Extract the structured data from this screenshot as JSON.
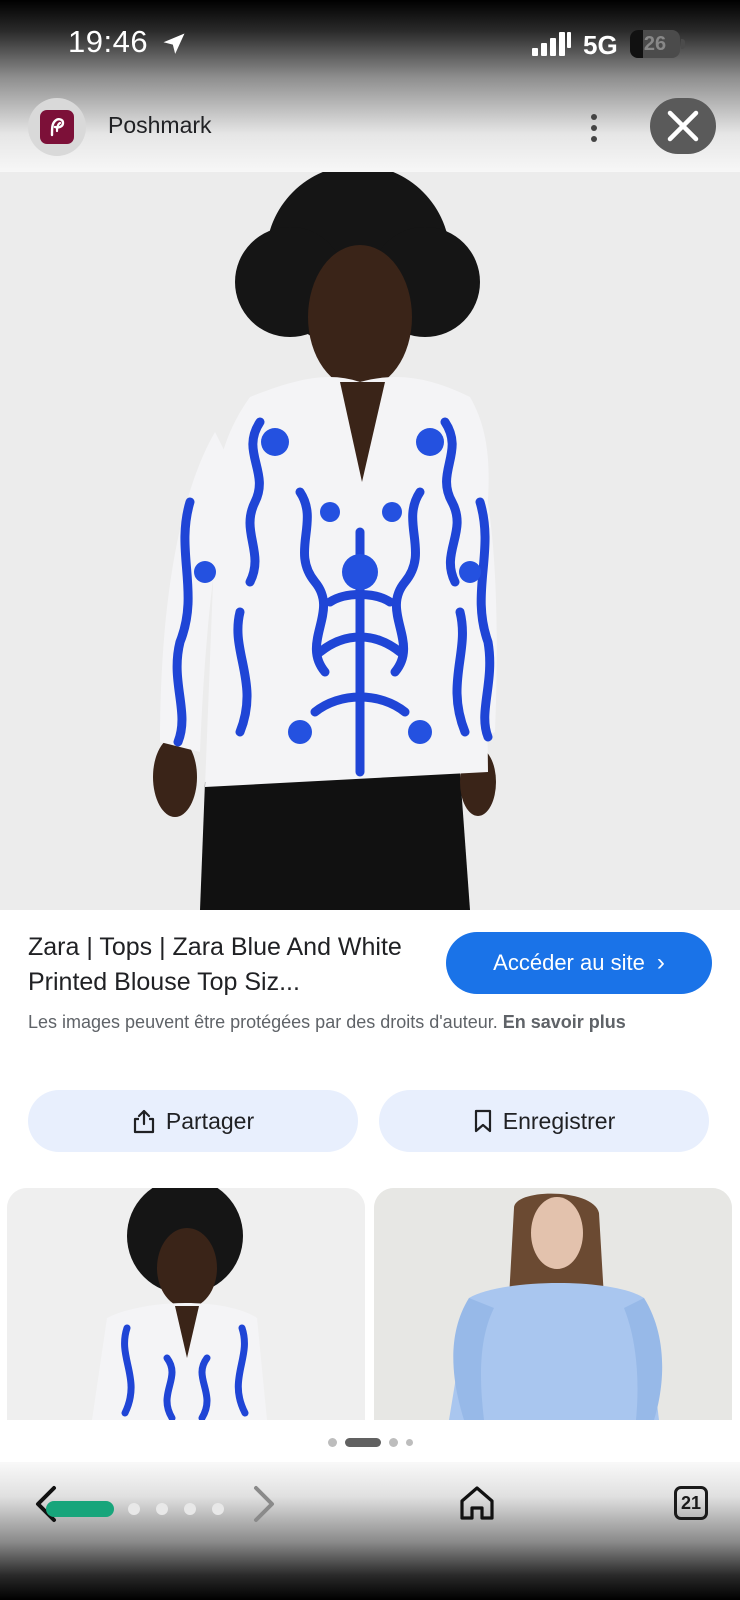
{
  "status_bar": {
    "time": "19:46",
    "network": "5G",
    "battery": "26",
    "battery_level": 0.26,
    "icons": [
      "location-arrow-icon",
      "signal-icon",
      "battery-icon"
    ]
  },
  "site_header": {
    "name": "Poshmark",
    "logo_color": "#7c1038",
    "icons": [
      "poshmark-logo-icon",
      "more-vert-icon",
      "close-icon"
    ]
  },
  "result": {
    "title": "Zara | Tops | Zara Blue And White Printed Blouse Top Siz...",
    "visit_label": "Accéder au site",
    "copyright_text": "Les images peuvent être protégées par des droits d'auteur.",
    "learn_more": "En savoir plus"
  },
  "actions": {
    "share_label": "Partager",
    "save_label": "Enregistrer"
  },
  "pager": {
    "count": 4,
    "active_index": 1
  },
  "bottom_nav": {
    "tabs_count": "21",
    "icons": [
      "back-icon",
      "forward-icon",
      "home-icon",
      "tabs-icon"
    ]
  },
  "colors": {
    "accent": "#1a73e8",
    "pill_bg": "#e8effd",
    "history_bar": "#17a57b"
  }
}
